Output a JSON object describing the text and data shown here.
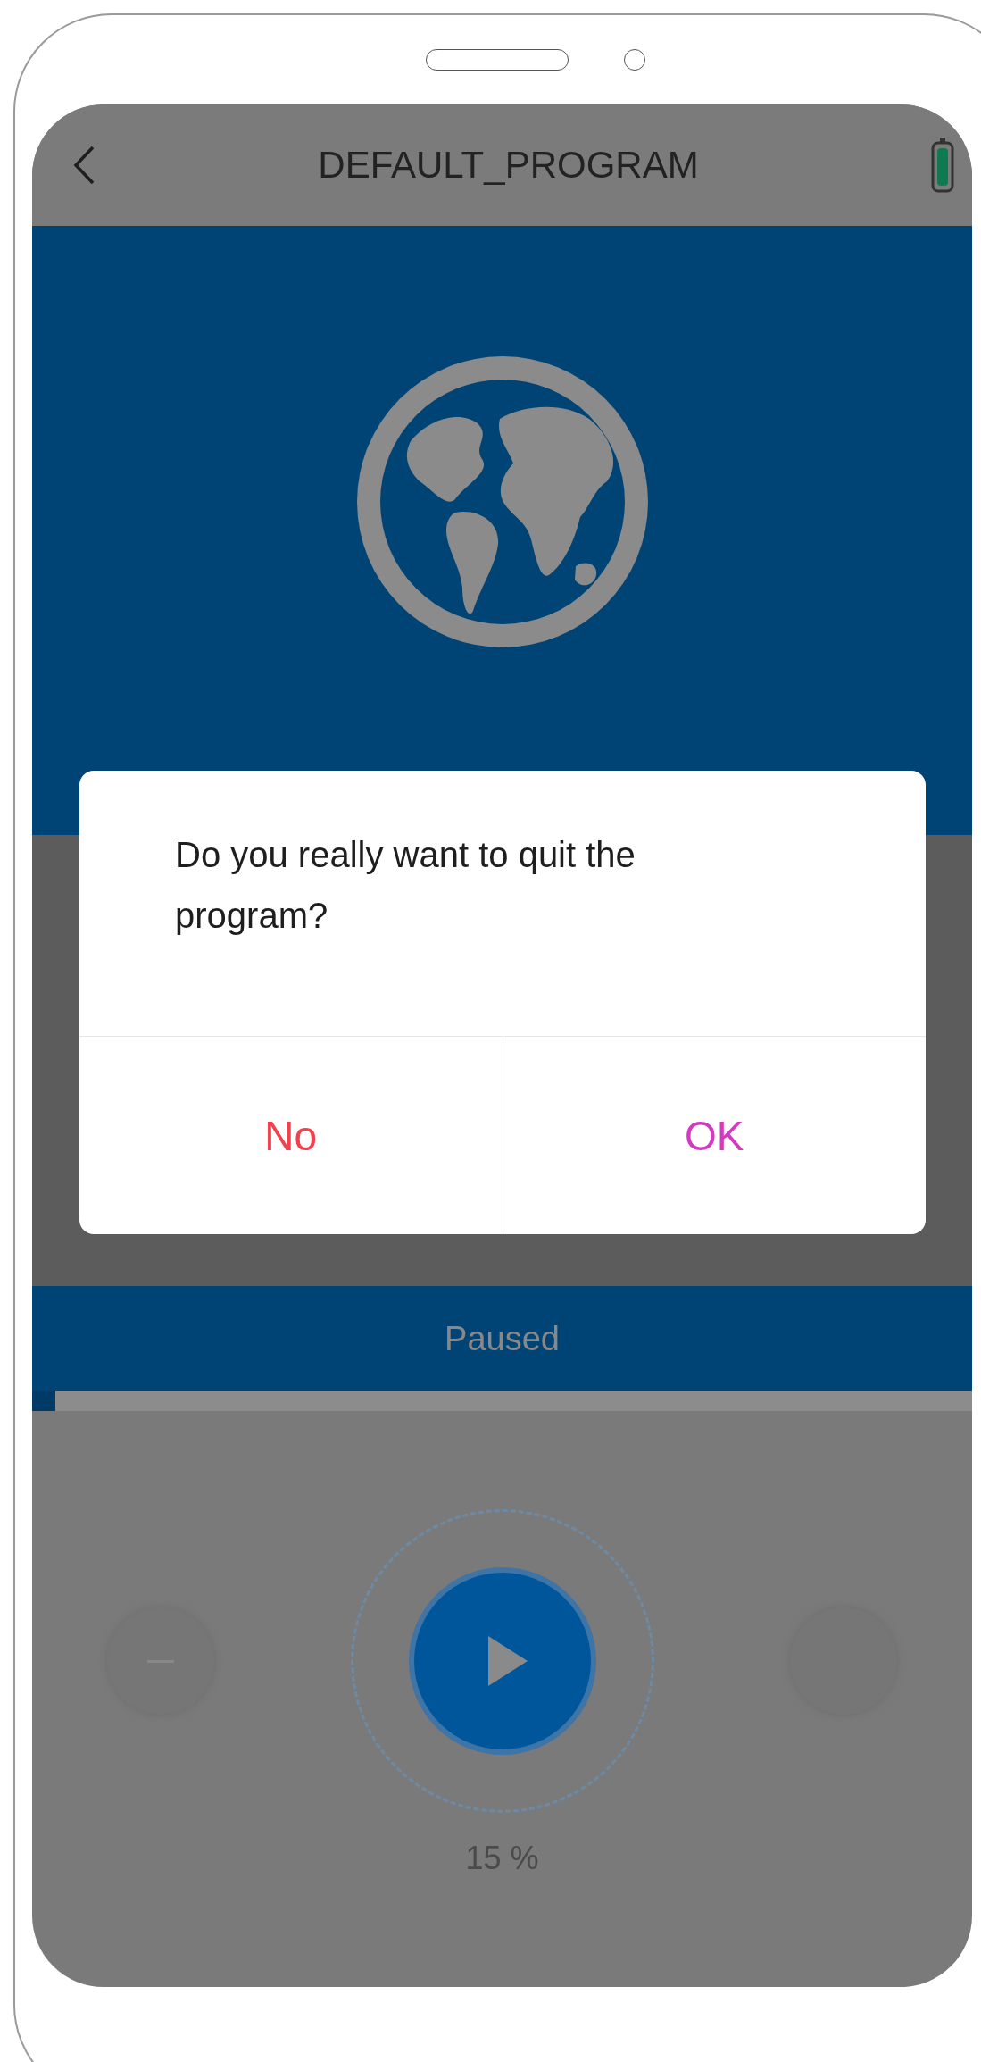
{
  "header": {
    "title": "DEFAULT_PROGRAM"
  },
  "dialog": {
    "message": "Do you really want to quit the program?",
    "buttons": [
      {
        "label": "No",
        "kind": "cancel"
      },
      {
        "label": "OK",
        "kind": "confirm"
      }
    ]
  },
  "status": {
    "label": "Paused"
  },
  "progress": {
    "level": 0.025
  },
  "player": {
    "percent": "15 %"
  }
}
